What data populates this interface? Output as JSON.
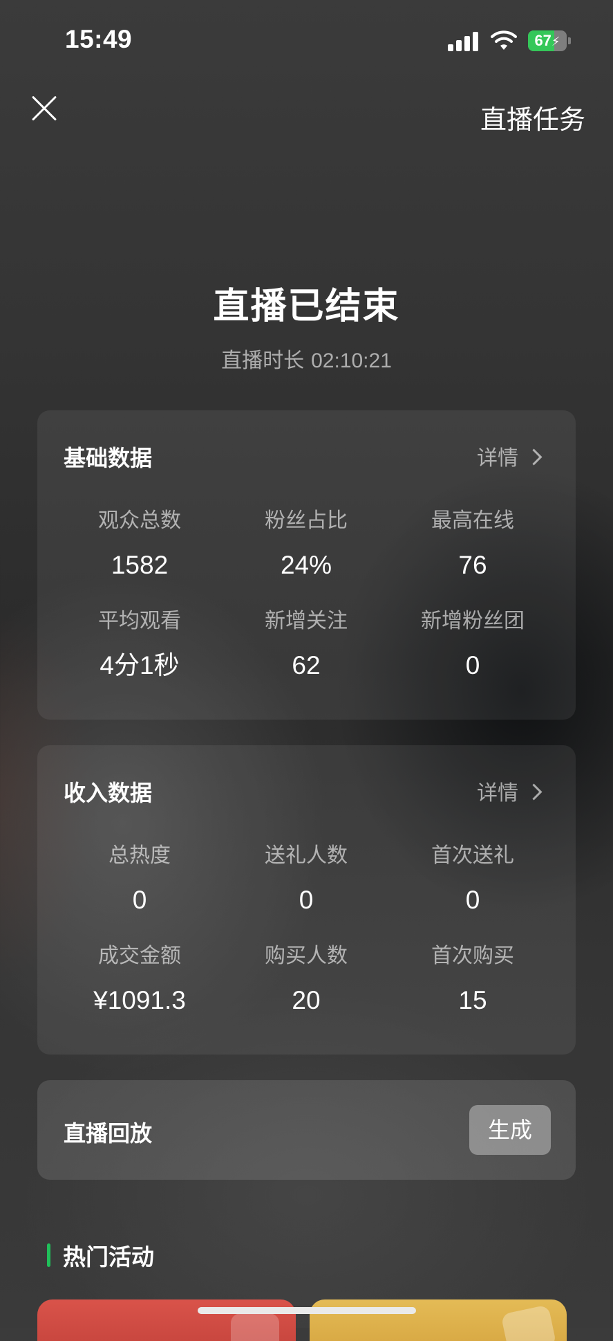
{
  "status_bar": {
    "time": "15:49",
    "battery_percent": 67,
    "battery_color": "#34c759",
    "icons": [
      "signal-icon",
      "wifi-icon",
      "battery-charging-icon"
    ]
  },
  "header": {
    "close_icon": "close-icon",
    "task_label": "直播任务"
  },
  "summary": {
    "title": "直播已结束",
    "duration_label": "直播时长",
    "duration_value": "02:10:21"
  },
  "basic_data": {
    "title": "基础数据",
    "detail_label": "详情",
    "stats": [
      {
        "label": "观众总数",
        "value": "1582"
      },
      {
        "label": "粉丝占比",
        "value": "24%"
      },
      {
        "label": "最高在线",
        "value": "76"
      },
      {
        "label": "平均观看",
        "value": "4分1秒"
      },
      {
        "label": "新增关注",
        "value": "62"
      },
      {
        "label": "新增粉丝团",
        "value": "0"
      }
    ]
  },
  "income_data": {
    "title": "收入数据",
    "detail_label": "详情",
    "stats": [
      {
        "label": "总热度",
        "value": "0"
      },
      {
        "label": "送礼人数",
        "value": "0"
      },
      {
        "label": "首次送礼",
        "value": "0"
      },
      {
        "label": "成交金额",
        "value": "¥1091.3"
      },
      {
        "label": "购买人数",
        "value": "20"
      },
      {
        "label": "首次购买",
        "value": "15"
      }
    ]
  },
  "replay": {
    "label": "直播回放",
    "button_label": "生成"
  },
  "hot_activities": {
    "title": "热门活动",
    "accent_color": "#20c05a",
    "cards": [
      {
        "color": "#d9534a"
      },
      {
        "color": "#e4bb56"
      }
    ]
  }
}
